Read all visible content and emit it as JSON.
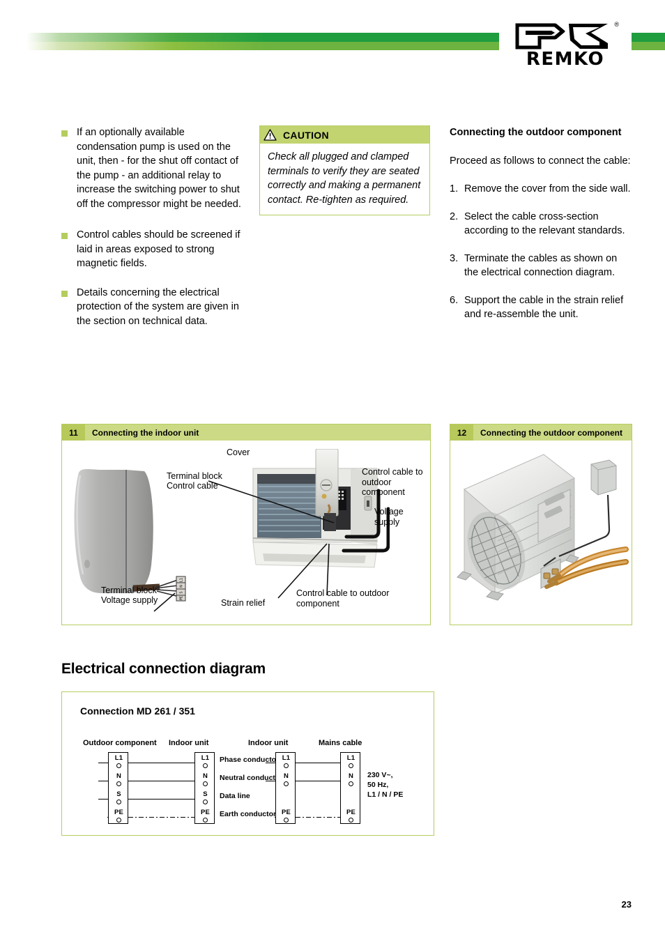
{
  "brand": {
    "name": "REMKO",
    "registered": "®",
    "bar_dark_green": "#1f9d3f",
    "bar_light_green": "#6cb33f"
  },
  "accent": {
    "olive_border": "#b5cd5f",
    "olive_fill": "#c2d470",
    "olive_num": "#b7c95a",
    "olive_title": "#ccda85",
    "bullet": "#b5cd5f"
  },
  "left_column": {
    "bullets": [
      "If an optionally available condensation pump is used on the unit, then - for the shut off contact of the pump - an additional relay to increase the switching power to shut off the compressor might be needed.",
      "Control cables should be screened if laid in areas exposed to strong magnetic fields.",
      "Details concerning the electrical protection of the system are given in the section on technical data."
    ]
  },
  "caution": {
    "icon": "warning-triangle-icon",
    "title": "CAUTION",
    "body": "Check all plugged and clamped terminals to verify they are seated correctly and making a permanent contact. Re-tighten as required."
  },
  "right_column": {
    "heading": "Connecting the outdoor component",
    "intro": "Proceed as follows to connect the cable:",
    "steps": [
      {
        "index": "1.",
        "text": "Remove the cover from the side wall."
      },
      {
        "index": "2.",
        "text": "Select the cable cross-section according to the relevant standards."
      },
      {
        "index": "3.",
        "text": "Terminate the cables as shown on the electrical connection diagram."
      },
      {
        "index": "6.",
        "text": "Support the cable in the strain relief and re-assemble the unit."
      }
    ]
  },
  "figures": [
    {
      "number": "11",
      "title": "Connecting the indoor unit",
      "callouts": [
        "Cover",
        "Terminal block",
        "Control cable",
        "Control cable to outdoor component",
        "Voltage supply",
        "Terminal block",
        "Voltage supply",
        "Strain relief",
        "Control cable to outdoor component"
      ]
    },
    {
      "number": "12",
      "title": "Connecting the outdoor component",
      "callouts": []
    }
  ],
  "section": {
    "heading": "Electrical connection diagram"
  },
  "diagram": {
    "title": "Connection MD 261 / 351",
    "column_headers": [
      "Outdoor component",
      "Indoor unit",
      "Indoor unit",
      "Mains cable"
    ],
    "signal_labels": [
      "Phase conductor",
      "Neutral conductor",
      "Data line",
      "Earth conductor"
    ],
    "left_pair": {
      "left_block_terminals": [
        "L1",
        "N",
        "S",
        "PE"
      ],
      "right_block_terminals": [
        "L1",
        "N",
        "S",
        "PE"
      ]
    },
    "right_pair": {
      "left_block_terminals": [
        "L1",
        "N",
        "PE"
      ],
      "right_block_terminals": [
        "L1",
        "N",
        "PE"
      ]
    },
    "supply_note": [
      "230 V~,",
      "50 Hz,",
      "L1 / N / PE"
    ]
  },
  "footer": {
    "page_number": "23"
  }
}
